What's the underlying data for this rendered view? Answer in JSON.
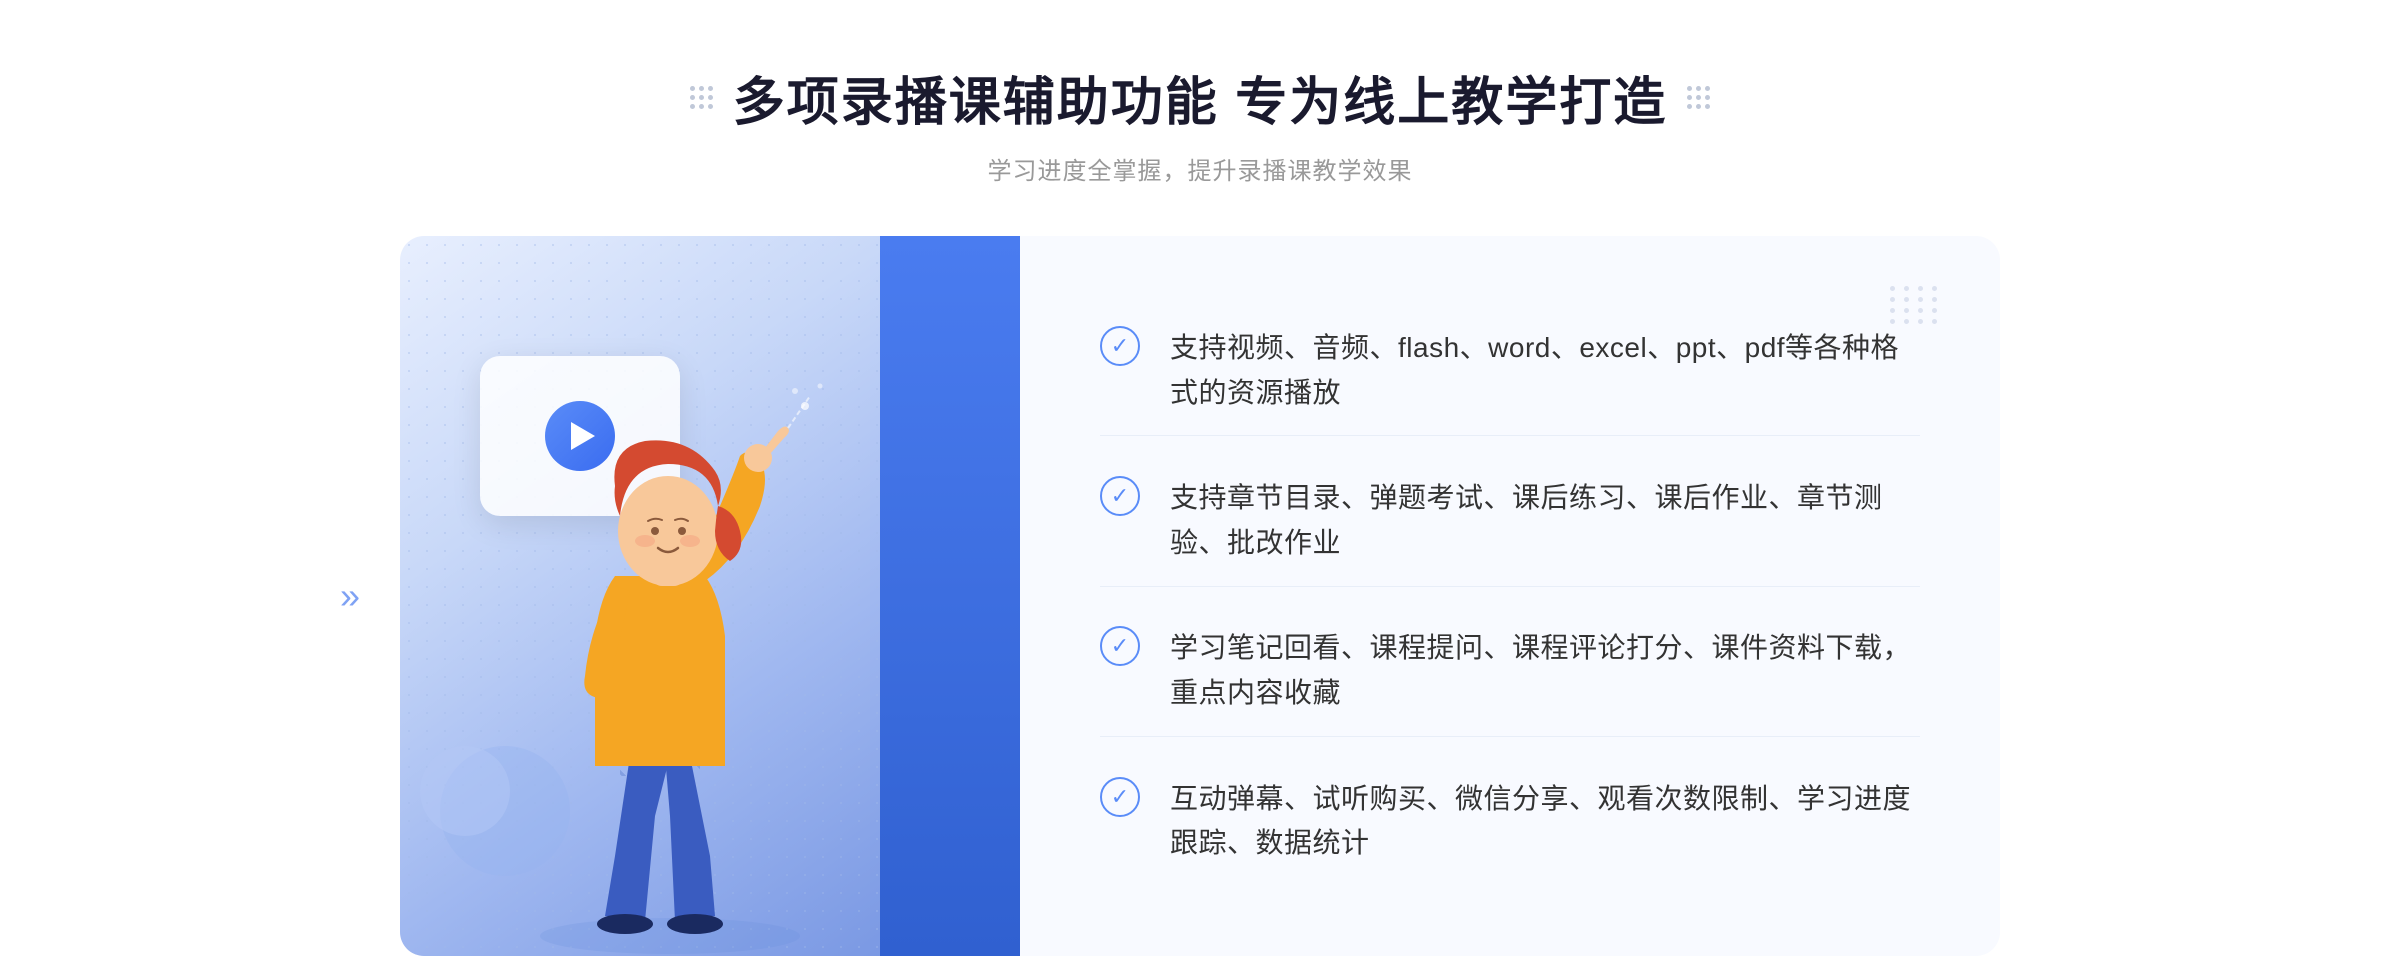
{
  "page": {
    "background": "#ffffff"
  },
  "header": {
    "title": "多项录播课辅助功能 专为线上教学打造",
    "subtitle": "学习进度全掌握，提升录播课教学效果"
  },
  "features": [
    {
      "id": 1,
      "text": "支持视频、音频、flash、word、excel、ppt、pdf等各种格式的资源播放"
    },
    {
      "id": 2,
      "text": "支持章节目录、弹题考试、课后练习、课后作业、章节测验、批改作业"
    },
    {
      "id": 3,
      "text": "学习笔记回看、课程提问、课程评论打分、课件资料下载，重点内容收藏"
    },
    {
      "id": 4,
      "text": "互动弹幕、试听购买、微信分享、观看次数限制、学习进度跟踪、数据统计"
    }
  ],
  "decorative": {
    "left_arrow": "»",
    "dots_label": "decorative-dots"
  }
}
